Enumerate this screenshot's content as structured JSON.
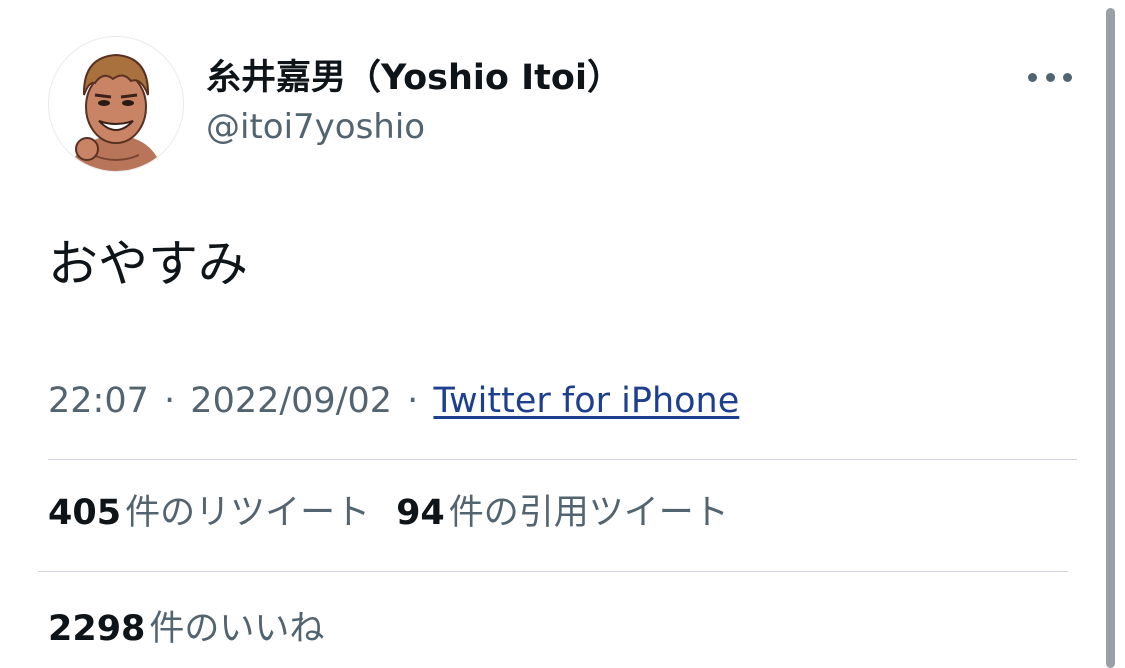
{
  "tweet": {
    "author_name": "糸井嘉男（Yoshio Itoi）",
    "author_handle": "@itoi7yoshio",
    "avatar_icon": "avatar-caricature",
    "more_icon": "more-options-icon",
    "text": "おやすみ",
    "time": "22:07",
    "date": "2022/09/02",
    "separator": "·",
    "source": "Twitter for iPhone"
  },
  "stats": {
    "retweets_count": "405",
    "retweets_label": "件のリツイート",
    "quotes_count": "94",
    "quotes_label": "件の引用ツイート",
    "likes_count": "2298",
    "likes_label": "件のいいね"
  },
  "colors": {
    "text_primary": "#0f1419",
    "text_secondary": "#536471",
    "link": "#1d3f8f",
    "divider": "#cfd5da"
  }
}
